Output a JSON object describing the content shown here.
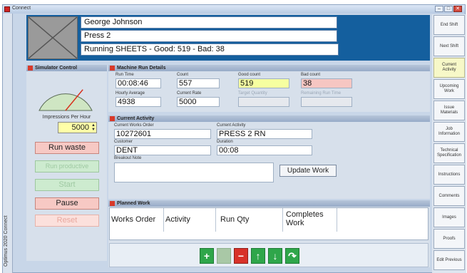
{
  "window": {
    "title": "Connect",
    "controls": [
      "–",
      "□",
      "✕"
    ]
  },
  "side_label": "Optimus 2020 Connect",
  "header": {
    "operator": "George Johnson",
    "machine": "Press 2",
    "status": "Running SHEETS - Good: 519 - Bad: 38"
  },
  "simulator": {
    "title": "Simulator Control",
    "impressions_label": "Impressions Per Hour",
    "impressions_value": "5000",
    "buttons": {
      "run_waste": "Run waste",
      "run_productive": "Run productive",
      "start": "Start",
      "pause": "Pause",
      "reset": "Reset"
    }
  },
  "machine_run": {
    "title": "Machine Run Details",
    "run_time_label": "Run Time",
    "run_time": "00:08:46",
    "count_label": "Count",
    "count": "557",
    "good_label": "Good count",
    "good": "519",
    "bad_label": "Bad count",
    "bad": "38",
    "hourly_avg_label": "Hourly Average",
    "hourly_avg": "4938",
    "current_rate_label": "Current Rate",
    "current_rate": "5000",
    "target_label": "Target Quantity",
    "target": "",
    "remaining_label": "Remaining Run Time",
    "remaining": ""
  },
  "current_activity": {
    "title": "Current Activity",
    "works_order_label": "Current Works Order",
    "works_order": "10272601",
    "activity_label": "Current Activity",
    "activity": "PRESS 2 RN",
    "customer_label": "Customer",
    "customer": "DENT",
    "duration_label": "Duration",
    "duration": "00:08",
    "breakout_label": "Breakout Note",
    "breakout": "",
    "update_button": "Update Work"
  },
  "planned_work": {
    "title": "Planned Work",
    "columns": [
      "Works Order",
      "Activity",
      "Run Qty",
      "Completes Work"
    ]
  },
  "toolbar": {
    "add": "+",
    "blank": "",
    "remove": "−",
    "up": "↑",
    "down": "↓",
    "redo": "↷"
  },
  "sidebar": {
    "items": [
      "End Shift",
      "Next Shift",
      "Current Activity",
      "Upcoming Work",
      "Issue Materials",
      "Job Information",
      "Technical Specification",
      "Instructions",
      "Comments",
      "Images",
      "Proofs",
      "Edit Previous"
    ],
    "active_index": 2
  },
  "colors": {
    "header_blue": "#145f9e",
    "active_sidebar": "#f7f8c8",
    "good": "#f6ffa0",
    "bad": "#f6c6c2"
  },
  "gauge_level_fraction": 0.72
}
